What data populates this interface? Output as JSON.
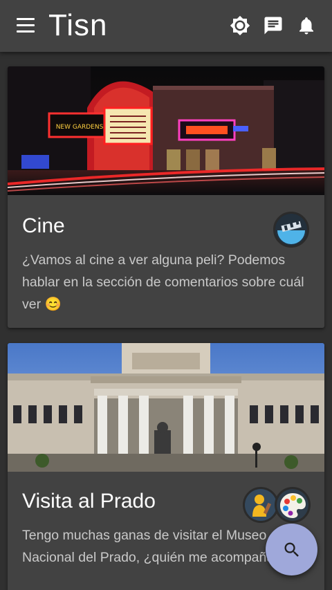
{
  "app": {
    "title": "Tisn"
  },
  "toolbar": {
    "icons": [
      "menu-icon",
      "brightness-icon",
      "chat-icon",
      "notifications-icon"
    ]
  },
  "cards": [
    {
      "title": "Cine",
      "description": "¿Vamos al cine a ver alguna peli? Podemos hablar en la sección de comentarios sobre cuál ver 😊",
      "image": "cinema-neon-night",
      "avatars": [
        "clapperboard-icon"
      ]
    },
    {
      "title": "Visita al Prado",
      "description": "Tengo muchas ganas de visitar el Museo Nacional del Prado, ¿quién me acompaña?",
      "image": "prado-museum-facade",
      "avatars": [
        "sculpture-icon",
        "palette-icon"
      ]
    }
  ],
  "fab": {
    "icon": "search-icon"
  },
  "colors": {
    "appbar": "#424242",
    "background": "#303030",
    "card": "#424242",
    "fab": "#9fa8da"
  }
}
